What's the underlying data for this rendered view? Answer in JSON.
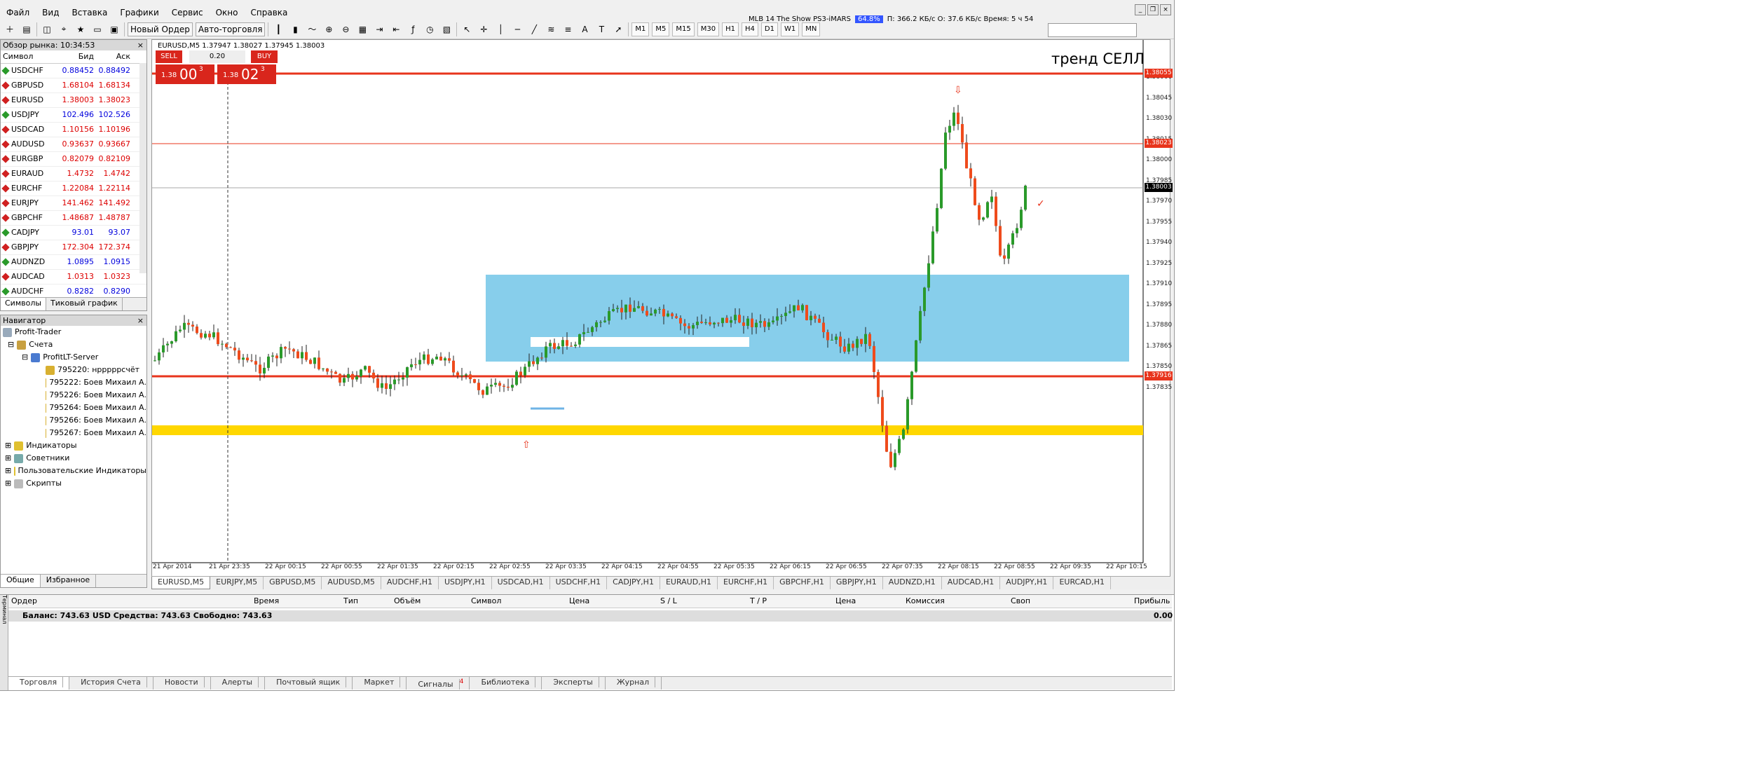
{
  "menu": [
    "Файл",
    "Вид",
    "Вставка",
    "Графики",
    "Сервис",
    "Окно",
    "Справка"
  ],
  "toolbar": {
    "new_order": "Новый Ордер",
    "auto_trading": "Авто-торговля",
    "timeframes": [
      "M1",
      "M5",
      "M15",
      "M30",
      "H1",
      "H4",
      "D1",
      "W1",
      "MN"
    ]
  },
  "ticker": {
    "title": "MLB 14 The Show PS3-iMARS",
    "progress": "64.8%",
    "stats": "П: 366.2 КБ/с   О: 37.6 КБ/с   Время: 5 ч 54"
  },
  "market_watch": {
    "title": "Обзор рынка: 10:34:53",
    "col_symbol": "Символ",
    "col_bid": "Бид",
    "col_ask": "Аск",
    "rows": [
      {
        "symbol": "USDCHF",
        "bid": "0.88452",
        "ask": "0.88492",
        "dir": "up"
      },
      {
        "symbol": "GBPUSD",
        "bid": "1.68104",
        "ask": "1.68134",
        "dir": "dn"
      },
      {
        "symbol": "EURUSD",
        "bid": "1.38003",
        "ask": "1.38023",
        "dir": "dn"
      },
      {
        "symbol": "USDJPY",
        "bid": "102.496",
        "ask": "102.526",
        "dir": "up"
      },
      {
        "symbol": "USDCAD",
        "bid": "1.10156",
        "ask": "1.10196",
        "dir": "dn"
      },
      {
        "symbol": "AUDUSD",
        "bid": "0.93637",
        "ask": "0.93667",
        "dir": "dn"
      },
      {
        "symbol": "EURGBP",
        "bid": "0.82079",
        "ask": "0.82109",
        "dir": "dn"
      },
      {
        "symbol": "EURAUD",
        "bid": "1.4732",
        "ask": "1.4742",
        "dir": "dn"
      },
      {
        "symbol": "EURCHF",
        "bid": "1.22084",
        "ask": "1.22114",
        "dir": "dn"
      },
      {
        "symbol": "EURJPY",
        "bid": "141.462",
        "ask": "141.492",
        "dir": "dn"
      },
      {
        "symbol": "GBPCHF",
        "bid": "1.48687",
        "ask": "1.48787",
        "dir": "dn"
      },
      {
        "symbol": "CADJPY",
        "bid": "93.01",
        "ask": "93.07",
        "dir": "up"
      },
      {
        "symbol": "GBPJPY",
        "bid": "172.304",
        "ask": "172.374",
        "dir": "dn"
      },
      {
        "symbol": "AUDNZD",
        "bid": "1.0895",
        "ask": "1.0915",
        "dir": "up"
      },
      {
        "symbol": "AUDCAD",
        "bid": "1.0313",
        "ask": "1.0323",
        "dir": "dn"
      },
      {
        "symbol": "AUDCHF",
        "bid": "0.8282",
        "ask": "0.8290",
        "dir": "up"
      }
    ],
    "tabs": [
      "Символы",
      "Тиковый график"
    ]
  },
  "navigator": {
    "title": "Навигатор",
    "root": "Profit-Trader",
    "accounts": "Счета",
    "server": "ProfitLT-Server",
    "account_items": [
      "795220: нрррррсчёт",
      "795222: Боев Михаил А.",
      "795226: Боев Михаил А.",
      "795264: Боев Михаил А.",
      "795266: Боев Михаил А.",
      "795267: Боев Михаил А."
    ],
    "sections": [
      "Индикаторы",
      "Советники",
      "Пользовательские Индикаторы",
      "Скрипты"
    ],
    "tabs": [
      "Общие",
      "Избранное"
    ]
  },
  "chart": {
    "title": "EURUSD,M5  1.37947 1.38027 1.37945 1.38003",
    "note": "тренд СЕЛЛ",
    "sell": "SELL",
    "buy": "BUY",
    "volume": "0.20",
    "sell_a": "1.38",
    "sell_b": "00",
    "sell_c": "3",
    "buy_a": "1.38",
    "buy_b": "02",
    "buy_c": "3",
    "price_ticks": [
      "1.38060",
      "1.38045",
      "1.38030",
      "1.38015",
      "1.38000",
      "1.37985",
      "1.37970",
      "1.37955",
      "1.37940",
      "1.37925",
      "1.37910",
      "1.37895",
      "1.37880",
      "1.37865",
      "1.37850",
      "1.37835"
    ],
    "price_labels": {
      "high": "1.38055",
      "ask": "1.38023",
      "bid": "1.38003",
      "support": "1.37916"
    },
    "time_ticks": [
      "21 Apr 2014",
      "21 Apr 23:35",
      "22 Apr 00:15",
      "22 Apr 00:55",
      "22 Apr 01:35",
      "22 Apr 02:15",
      "22 Apr 02:55",
      "22 Apr 03:35",
      "22 Apr 04:15",
      "22 Apr 04:55",
      "22 Apr 05:35",
      "22 Apr 06:15",
      "22 Apr 06:55",
      "22 Apr 07:35",
      "22 Apr 08:15",
      "22 Apr 08:55",
      "22 Apr 09:35",
      "22 Apr 10:15"
    ],
    "tabs": [
      "EURUSD,M5",
      "EURJPY,M5",
      "GBPUSD,M5",
      "AUDUSD,M5",
      "AUDCHF,H1",
      "USDJPY,H1",
      "USDCAD,H1",
      "USDCHF,H1",
      "CADJPY,H1",
      "EURAUD,H1",
      "EURCHF,H1",
      "GBPCHF,H1",
      "GBPJPY,H1",
      "AUDNZD,H1",
      "AUDCAD,H1",
      "AUDJPY,H1",
      "EURCAD,H1"
    ],
    "colors": {
      "bull": "#2a9a2a",
      "bear": "#ef4b1c",
      "zone": "#87ceeb",
      "yellow": "#ffd700",
      "redline": "#e8341c"
    }
  },
  "terminal": {
    "side_label": "Терминал",
    "columns": [
      "Ордер",
      "Время",
      "Тип",
      "Объём",
      "Символ",
      "Цена",
      "S / L",
      "T / P",
      "Цена",
      "Комиссия",
      "Своп",
      "Прибыль"
    ],
    "balance": "Баланс: 743.63 USD  Средства: 743.63  Свободно: 743.63",
    "profit": "0.00",
    "tabs": [
      "Торговля",
      "История Счета",
      "Новости",
      "Алерты",
      "Почтовый ящик",
      "Маркет",
      "Сигналы",
      "Библиотека",
      "Эксперты",
      "Журнал"
    ],
    "signals_badge": "4"
  }
}
